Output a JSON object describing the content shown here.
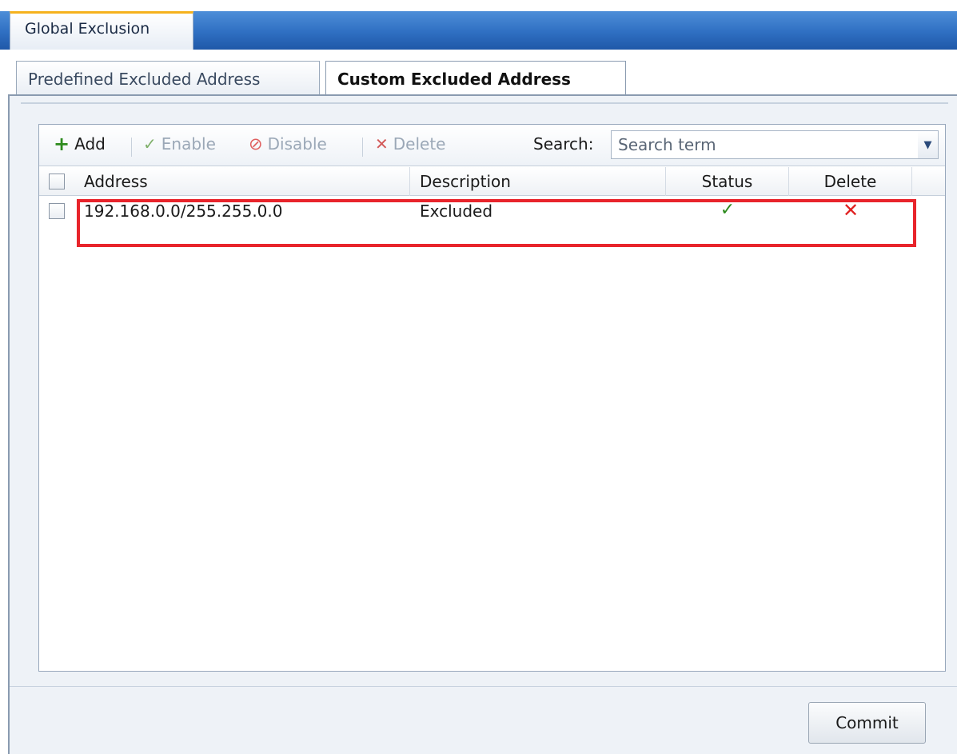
{
  "window": {
    "tab_label": "Global Exclusion"
  },
  "tabs": [
    {
      "label": "Predefined Excluded Address",
      "active": false
    },
    {
      "label": "Custom Excluded Address",
      "active": true
    }
  ],
  "toolbar": {
    "add_label": "Add",
    "enable_label": "Enable",
    "disable_label": "Disable",
    "delete_label": "Delete",
    "search_label": "Search:",
    "search_placeholder": "Search term"
  },
  "table": {
    "columns": [
      "Address",
      "Description",
      "Status",
      "Delete"
    ],
    "rows": [
      {
        "address": "192.168.0.0/255.255.0.0",
        "description": "Excluded",
        "status": "enabled",
        "status_icon": "check-icon",
        "delete_icon": "x-icon"
      }
    ]
  },
  "footer": {
    "commit_label": "Commit"
  },
  "colors": {
    "accent_blue": "#2f6fc2",
    "tab_highlight": "#f5b21d",
    "highlight_box": "#e8242b",
    "status_ok": "#2e8b1e",
    "delete_red": "#e02020"
  }
}
